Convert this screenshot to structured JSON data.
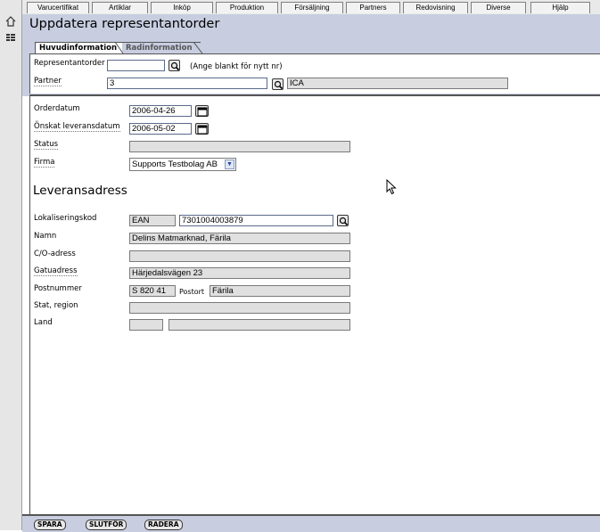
{
  "menu": [
    "Varucertifikat",
    "Artiklar",
    "Inköp",
    "Produktion",
    "Försäljning",
    "Partners",
    "Redovisning",
    "Diverse",
    "Hjälp"
  ],
  "page_title": "Uppdatera representantorder",
  "tabs": {
    "main": "Huvudinformation",
    "rows": "Radinformation"
  },
  "header": {
    "order_label": "Representantorder",
    "order_value": "",
    "order_hint": "(Ange blankt för nytt nr)",
    "partner_label": "Partner",
    "partner_value": "3",
    "partner_name": "ICA"
  },
  "order": {
    "orderdate_label": "Orderdatum",
    "orderdate_value": "2006-04-26",
    "delivery_label": "Önskat leveransdatum",
    "delivery_value": "2006-05-02",
    "status_label": "Status",
    "status_value": "",
    "company_label": "Firma",
    "company_value": "Supports Testbolag AB"
  },
  "delivery_address": {
    "heading": "Leveransadress",
    "location_label": "Lokaliseringskod",
    "location_type": "EAN",
    "location_code": "7301004003879",
    "name_label": "Namn",
    "name_value": "Delins Matmarknad, Färila",
    "co_label": "C/O-adress",
    "co_value": "",
    "street_label": "Gatuadress",
    "street_value": "Härjedalsvägen 23",
    "postcode_label": "Postnummer",
    "postcode_value": "S 820 41",
    "city_label": "Postort",
    "city_value": "Färila",
    "state_label": "Stat, region",
    "state_value": "",
    "country_label": "Land",
    "country_code": "",
    "country_name": ""
  },
  "footer": {
    "save": "SPARA",
    "finish": "SLUTFÖR",
    "delete": "RADERA"
  }
}
